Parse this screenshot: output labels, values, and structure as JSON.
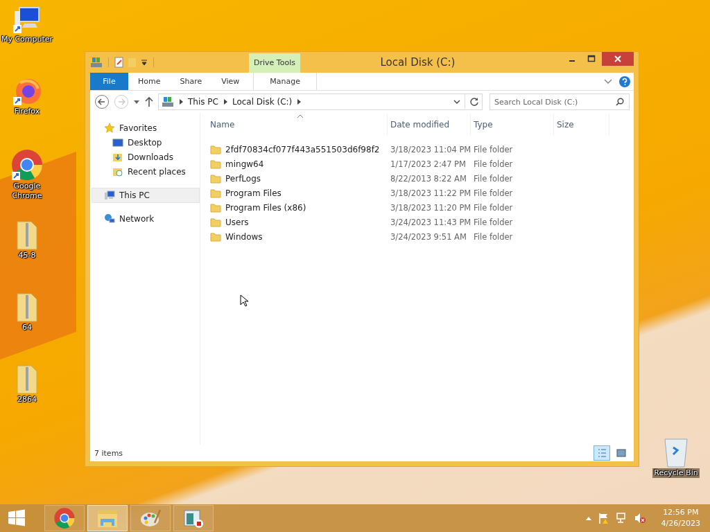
{
  "desktop_icons": [
    {
      "label": "My Computer",
      "kind": "computer"
    },
    {
      "label": "Firefox",
      "kind": "firefox"
    },
    {
      "label": "Google Chrome",
      "kind": "chrome"
    },
    {
      "label": "45-8",
      "kind": "zip"
    },
    {
      "label": "64",
      "kind": "zip"
    },
    {
      "label": "2864",
      "kind": "zip"
    }
  ],
  "recycle_bin": {
    "label": "Recycle Bin"
  },
  "window": {
    "title": "Local Disk (C:)",
    "context_group": "Drive Tools",
    "ribbon_tabs": [
      {
        "label": "File",
        "kind": "file",
        "selected": false
      },
      {
        "label": "Home",
        "kind": "tab",
        "selected": false
      },
      {
        "label": "Share",
        "kind": "tab",
        "selected": false
      },
      {
        "label": "View",
        "kind": "tab",
        "selected": false
      },
      {
        "label": "Manage",
        "kind": "context",
        "selected": false
      }
    ],
    "address": {
      "crumbs": [
        "This PC",
        "Local Disk (C:)"
      ]
    },
    "search": {
      "placeholder": "Search Local Disk (C:)"
    },
    "nav": [
      {
        "label": "Favorites",
        "kind": "star",
        "selected": false,
        "children": [
          {
            "label": "Desktop",
            "kind": "desktop",
            "selected": false
          },
          {
            "label": "Downloads",
            "kind": "download",
            "selected": false
          },
          {
            "label": "Recent places",
            "kind": "recent",
            "selected": false
          }
        ]
      },
      {
        "label": "This PC",
        "kind": "pc",
        "selected": true
      },
      {
        "label": "Network",
        "kind": "network",
        "selected": false
      }
    ],
    "columns": [
      {
        "label": "Name",
        "sorted": true
      },
      {
        "label": "Date modified",
        "sorted": false
      },
      {
        "label": "Type",
        "sorted": false
      },
      {
        "label": "Size",
        "sorted": false
      }
    ],
    "rows": [
      {
        "name": "2fdf70834cf077f443a551503d6f98f2",
        "date": "3/18/2023 11:04 PM",
        "type": "File folder"
      },
      {
        "name": "mingw64",
        "date": "1/17/2023 2:47 PM",
        "type": "File folder"
      },
      {
        "name": "PerfLogs",
        "date": "8/22/2013 8:22 AM",
        "type": "File folder"
      },
      {
        "name": "Program Files",
        "date": "3/18/2023 11:22 PM",
        "type": "File folder"
      },
      {
        "name": "Program Files (x86)",
        "date": "3/18/2023 11:20 PM",
        "type": "File folder"
      },
      {
        "name": "Users",
        "date": "3/24/2023 11:43 PM",
        "type": "File folder"
      },
      {
        "name": "Windows",
        "date": "3/24/2023 9:51 AM",
        "type": "File folder"
      }
    ],
    "status": "7 items",
    "views": [
      {
        "kind": "details",
        "selected": true
      },
      {
        "kind": "tiles",
        "selected": false
      }
    ]
  },
  "taskbar": {
    "items": [
      {
        "kind": "chrome",
        "selected": false
      },
      {
        "kind": "explorer",
        "selected": true
      },
      {
        "kind": "paint",
        "selected": false
      },
      {
        "kind": "recorder",
        "selected": false
      }
    ],
    "time": "12:56 PM",
    "date": "4/26/2023"
  }
}
